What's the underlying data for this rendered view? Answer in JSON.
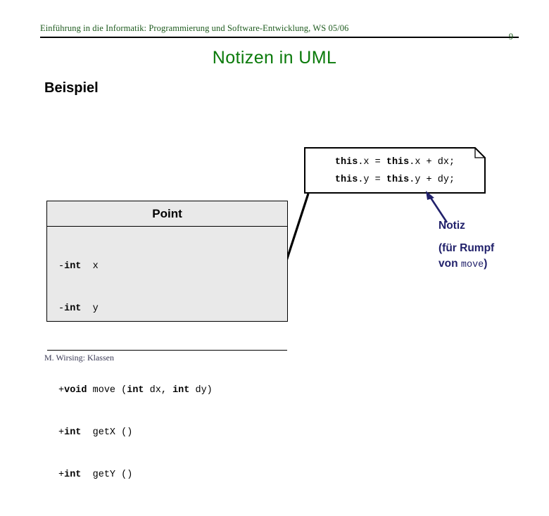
{
  "header": {
    "course_line": "Einführung in die Informatik: Programmierung und Software-Entwicklung, WS 05/06",
    "page_number": "9",
    "rule_color": "#000000",
    "text_color": "#1d5a1d"
  },
  "title": {
    "text": "Notizen in UML",
    "color": "#0a7a0a"
  },
  "subtitle": {
    "text": "Beispiel",
    "color": "#000000"
  },
  "note": {
    "line1": {
      "kw1": "this",
      "mid1": ".x = ",
      "kw2": "this",
      "mid2": ".x + dx;"
    },
    "line2": {
      "kw1": "this",
      "mid1": ".y = ",
      "kw2": "this",
      "mid2": ".y + dy;"
    },
    "border_color": "#000000",
    "fill_color": "#ffffff"
  },
  "uml_class": {
    "name": "Point",
    "header_fill": "#e9e9e9",
    "border_color": "#000000",
    "attributes": [
      {
        "visibility": "-",
        "type": "int",
        "name": "  x"
      },
      {
        "visibility": "-",
        "type": "int",
        "name": "  y"
      }
    ],
    "operations": [
      {
        "visibility": "+",
        "type": "void",
        "name": " move (",
        "param_type1": "int",
        "param_name1": " dx, ",
        "param_type2": "int",
        "param_name2": " dy)"
      },
      {
        "visibility": "+",
        "type": "int",
        "name": "  getX ()"
      },
      {
        "visibility": "+",
        "type": "int",
        "name": "  getY ()"
      }
    ]
  },
  "annotation": {
    "title": "Notiz",
    "sub_prefix": "(für Rumpf",
    "sub_line2_prefix": "von ",
    "sub_line2_mono": "move",
    "sub_line2_suffix": ")",
    "color": "#21216b"
  },
  "footer": {
    "text": "M. Wirsing: Klassen",
    "color": "#3a3a55"
  }
}
